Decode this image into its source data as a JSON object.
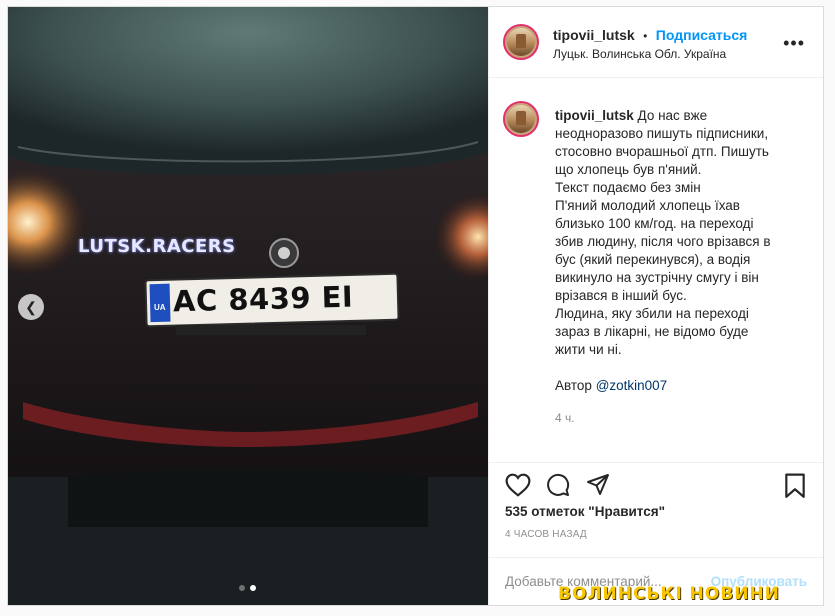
{
  "header": {
    "username": "tipovii_lutsk",
    "separator": "•",
    "follow_label": "Подписаться",
    "location": "Луцьк. Волинська Обл. Україна",
    "more_icon": "more-horizontal-icon"
  },
  "media": {
    "prev_icon": "chevron-left-icon",
    "plate_text": "AC 8439 EI",
    "plate_country": "UA",
    "decal_text": "LUTSK.RACERS",
    "dots": {
      "count": 2,
      "active_index": 1
    }
  },
  "caption": {
    "username": "tipovii_lutsk",
    "line1": "До нас вже неодноразово пишуть підписники, стосовно вчорашньої дтп. Пишуть що хлопець був п'яний.",
    "line2": "Текст подаємо без змін",
    "line3": "П'яний молодий хлопець їхав близько 100 км/год. на переході збив людину, після чого врізався в бус (який перекинувся), а водія викинуло на зустрічну смугу і він врізався в інший бус.",
    "line4": "Людина, яку збили на переході зараз в лікарні, не відомо буде жити чи ні.",
    "author_prefix": "Автор ",
    "author_mention": "@zotkin007",
    "time_ago": "4 ч."
  },
  "actions": {
    "like_icon": "heart-icon",
    "comment_icon": "comment-icon",
    "share_icon": "share-icon",
    "save_icon": "bookmark-icon"
  },
  "likes_text": "535 отметок \"Нравится\"",
  "posted_text": "4 ЧАСОВ НАЗАД",
  "comment": {
    "placeholder": "Добавьте комментарий...",
    "publish_label": "Опубликовать"
  },
  "watermark": "ВОЛИНСЬКІ НОВИНИ",
  "colors": {
    "accent": "#0095f6",
    "watermark": "#f7c600",
    "publish_disabled": "#b2dffc"
  }
}
